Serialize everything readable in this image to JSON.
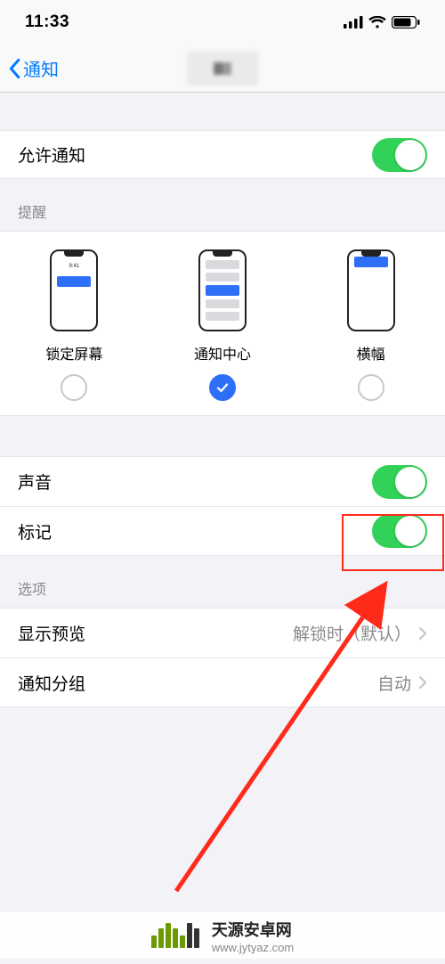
{
  "status": {
    "time": "11:33"
  },
  "nav": {
    "back": "通知"
  },
  "allow": {
    "label": "允许通知",
    "on": true
  },
  "alerts": {
    "header": "提醒",
    "options": [
      {
        "label": "锁定屏幕",
        "checked": false
      },
      {
        "label": "通知中心",
        "checked": true
      },
      {
        "label": "横幅",
        "checked": false
      }
    ],
    "lock_time": "9:41"
  },
  "sounds": {
    "label": "声音",
    "on": true
  },
  "badges": {
    "label": "标记",
    "on": true
  },
  "options": {
    "header": "选项",
    "preview": {
      "label": "显示预览",
      "value": "解锁时（默认）"
    },
    "grouping": {
      "label": "通知分组",
      "value": "自动"
    }
  },
  "watermark": {
    "brand": "天源安卓网",
    "url": "www.jytyaz.com"
  }
}
